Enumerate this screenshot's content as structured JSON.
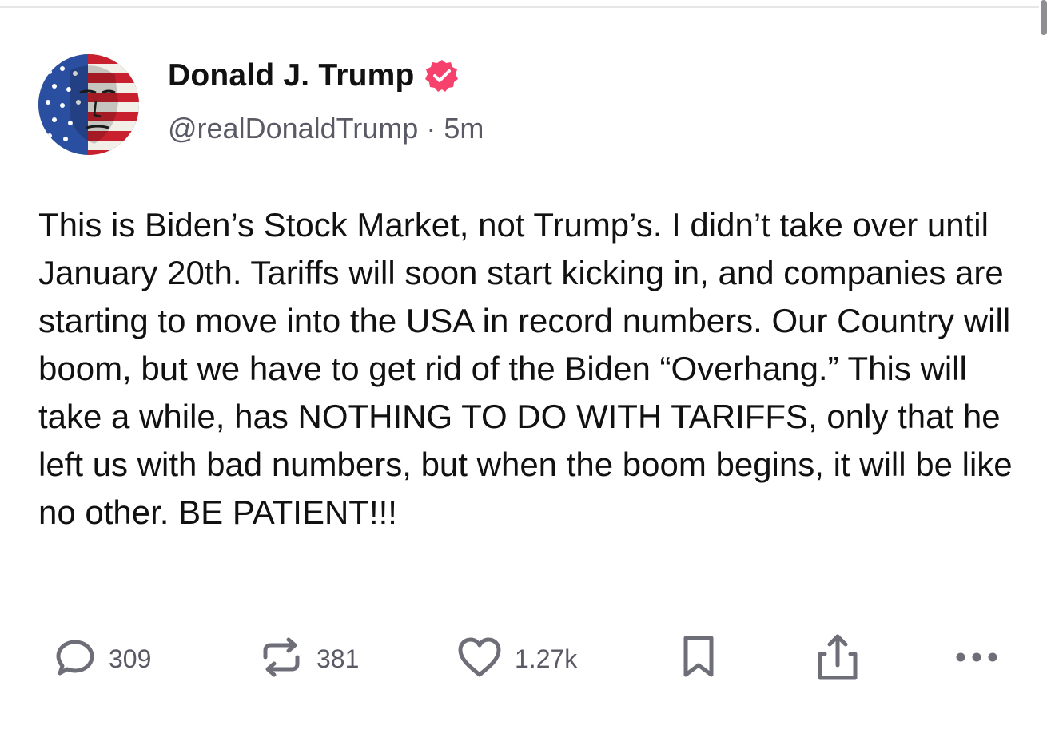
{
  "post": {
    "author": {
      "display_name": "Donald J. Trump",
      "handle": "@realDonaldTrump",
      "separator": "·",
      "time_ago": "5m",
      "verified": true
    },
    "body": "This is Biden’s Stock Market, not Trump’s. I didn’t take over until January 20th. Tariffs will soon start kicking in, and companies are starting to move into the USA in record numbers. Our Country will boom, but we have to get rid of the Biden “Overhang.” This will take a while, has NOTHING TO DO WITH TARIFFS, only that he left us with bad numbers, but when the boom begins, it will be like no other. BE PATIENT!!!",
    "actions": {
      "replies": "309",
      "reposts": "381",
      "likes": "1.27k"
    }
  },
  "icons": {
    "reply": "reply-bubble-icon",
    "repost": "repost-arrows-icon",
    "like": "heart-icon",
    "bookmark": "bookmark-icon",
    "share": "share-icon",
    "more": "more-dots-icon",
    "verified": "verified-badge-icon"
  },
  "colors": {
    "verified_badge": "#f5416c",
    "icon_gray": "#6e6e78",
    "text_secondary": "#5a5a66"
  }
}
